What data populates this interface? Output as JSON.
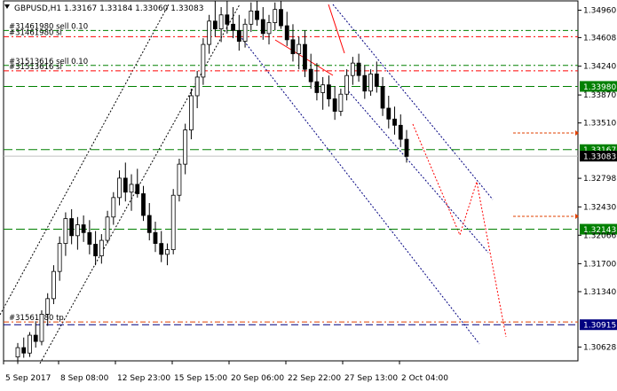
{
  "window": {
    "title": "GBPUSD,H1  1.33167 1.33184 1.33060 1.33083"
  },
  "colors": {
    "background": "#ffffff",
    "candle": "#000000",
    "price_badge": "#008000",
    "price_badge_text": "#ffffff",
    "green_line": "#008000",
    "red_line": "#ff0000",
    "orange_line": "#e04000",
    "blue_line": "#000080"
  },
  "chart_data": {
    "type": "candlestick",
    "title": "GBPUSD,H1  1.33167 1.33184 1.33060 1.33083",
    "ylim": [
      1.3045,
      1.3508
    ],
    "y_ticks": [
      1.3496,
      1.34608,
      1.3424,
      1.3387,
      1.3351,
      1.32798,
      1.3243,
      1.32066,
      1.317,
      1.3134,
      1.30628
    ],
    "x_ticks": [
      "5 Sep 2017",
      "8 Sep 08:00",
      "12 Sep 23:00",
      "15 Sep 15:00",
      "20 Sep 06:00",
      "22 Sep 22:00",
      "27 Sep 13:00",
      "2 Oct 04:00"
    ],
    "price_levels": [
      {
        "label": "1.33980",
        "value": 1.3398,
        "style": "green-dash"
      },
      {
        "label": "1.33167",
        "value": 1.33167,
        "style": "green-dash"
      },
      {
        "label": "1.33083",
        "value": 1.33083,
        "style": "bid"
      },
      {
        "label": "1.32143",
        "value": 1.32143,
        "style": "green-dash"
      },
      {
        "label": "1.30915",
        "value": 1.30915,
        "style": "blue-dash"
      }
    ],
    "orders": [
      {
        "label": "#31461980 sell 0.10",
        "value": 1.347
      },
      {
        "label": "#31461980 sl",
        "value": 1.3462
      },
      {
        "label": "#31513616 sell 0.10",
        "value": 1.3425
      },
      {
        "label": "#31513616 sl",
        "value": 1.3418
      },
      {
        "label": "#31561980 tp",
        "value": 1.3095
      }
    ],
    "candles": [
      {
        "o": 1.305,
        "h": 1.3068,
        "l": 1.3041,
        "c": 1.3062
      },
      {
        "o": 1.3062,
        "h": 1.3075,
        "l": 1.3049,
        "c": 1.3055
      },
      {
        "o": 1.3055,
        "h": 1.3082,
        "l": 1.305,
        "c": 1.3078
      },
      {
        "o": 1.3078,
        "h": 1.3096,
        "l": 1.3062,
        "c": 1.307
      },
      {
        "o": 1.307,
        "h": 1.311,
        "l": 1.3065,
        "c": 1.3105
      },
      {
        "o": 1.3105,
        "h": 1.3132,
        "l": 1.309,
        "c": 1.3125
      },
      {
        "o": 1.3125,
        "h": 1.3168,
        "l": 1.3118,
        "c": 1.316
      },
      {
        "o": 1.316,
        "h": 1.3205,
        "l": 1.3148,
        "c": 1.3196
      },
      {
        "o": 1.3196,
        "h": 1.3236,
        "l": 1.318,
        "c": 1.3228
      },
      {
        "o": 1.3228,
        "h": 1.324,
        "l": 1.3195,
        "c": 1.3206
      },
      {
        "o": 1.3206,
        "h": 1.323,
        "l": 1.3188,
        "c": 1.322
      },
      {
        "o": 1.322,
        "h": 1.3232,
        "l": 1.3198,
        "c": 1.321
      },
      {
        "o": 1.321,
        "h": 1.3226,
        "l": 1.3182,
        "c": 1.3195
      },
      {
        "o": 1.3195,
        "h": 1.3212,
        "l": 1.3168,
        "c": 1.318
      },
      {
        "o": 1.318,
        "h": 1.3208,
        "l": 1.317,
        "c": 1.32
      },
      {
        "o": 1.32,
        "h": 1.3238,
        "l": 1.3196,
        "c": 1.323
      },
      {
        "o": 1.323,
        "h": 1.3262,
        "l": 1.322,
        "c": 1.3255
      },
      {
        "o": 1.3255,
        "h": 1.329,
        "l": 1.3245,
        "c": 1.328
      },
      {
        "o": 1.328,
        "h": 1.33,
        "l": 1.325,
        "c": 1.3262
      },
      {
        "o": 1.3262,
        "h": 1.3285,
        "l": 1.3238,
        "c": 1.3272
      },
      {
        "o": 1.3272,
        "h": 1.3292,
        "l": 1.3255,
        "c": 1.326
      },
      {
        "o": 1.326,
        "h": 1.327,
        "l": 1.3225,
        "c": 1.3232
      },
      {
        "o": 1.3232,
        "h": 1.3248,
        "l": 1.32,
        "c": 1.321
      },
      {
        "o": 1.321,
        "h": 1.3224,
        "l": 1.3185,
        "c": 1.3196
      },
      {
        "o": 1.3196,
        "h": 1.3212,
        "l": 1.3172,
        "c": 1.3182
      },
      {
        "o": 1.3182,
        "h": 1.3196,
        "l": 1.3168,
        "c": 1.3188
      },
      {
        "o": 1.3188,
        "h": 1.3266,
        "l": 1.3182,
        "c": 1.3258
      },
      {
        "o": 1.3258,
        "h": 1.3305,
        "l": 1.325,
        "c": 1.3298
      },
      {
        "o": 1.3298,
        "h": 1.335,
        "l": 1.3285,
        "c": 1.3342
      },
      {
        "o": 1.3342,
        "h": 1.3395,
        "l": 1.333,
        "c": 1.3386
      },
      {
        "o": 1.3386,
        "h": 1.3418,
        "l": 1.337,
        "c": 1.341
      },
      {
        "o": 1.341,
        "h": 1.346,
        "l": 1.34,
        "c": 1.3452
      },
      {
        "o": 1.3452,
        "h": 1.349,
        "l": 1.344,
        "c": 1.3482
      },
      {
        "o": 1.3482,
        "h": 1.3508,
        "l": 1.3462,
        "c": 1.3472
      },
      {
        "o": 1.3472,
        "h": 1.35,
        "l": 1.3455,
        "c": 1.349
      },
      {
        "o": 1.349,
        "h": 1.3508,
        "l": 1.3466,
        "c": 1.3478
      },
      {
        "o": 1.3478,
        "h": 1.35,
        "l": 1.346,
        "c": 1.347
      },
      {
        "o": 1.347,
        "h": 1.349,
        "l": 1.3444,
        "c": 1.3456
      },
      {
        "o": 1.3456,
        "h": 1.3485,
        "l": 1.3448,
        "c": 1.3478
      },
      {
        "o": 1.3478,
        "h": 1.3506,
        "l": 1.3468,
        "c": 1.3495
      },
      {
        "o": 1.3495,
        "h": 1.3508,
        "l": 1.3476,
        "c": 1.3484
      },
      {
        "o": 1.3484,
        "h": 1.35,
        "l": 1.3458,
        "c": 1.3466
      },
      {
        "o": 1.3466,
        "h": 1.349,
        "l": 1.3452,
        "c": 1.348
      },
      {
        "o": 1.348,
        "h": 1.3506,
        "l": 1.347,
        "c": 1.3497
      },
      {
        "o": 1.3497,
        "h": 1.3508,
        "l": 1.3472,
        "c": 1.3476
      },
      {
        "o": 1.3476,
        "h": 1.3494,
        "l": 1.345,
        "c": 1.3458
      },
      {
        "o": 1.3458,
        "h": 1.3478,
        "l": 1.343,
        "c": 1.344
      },
      {
        "o": 1.344,
        "h": 1.3462,
        "l": 1.342,
        "c": 1.3452
      },
      {
        "o": 1.3452,
        "h": 1.347,
        "l": 1.341,
        "c": 1.342
      },
      {
        "o": 1.342,
        "h": 1.344,
        "l": 1.3395,
        "c": 1.3404
      },
      {
        "o": 1.3404,
        "h": 1.3428,
        "l": 1.338,
        "c": 1.339
      },
      {
        "o": 1.339,
        "h": 1.341,
        "l": 1.3368,
        "c": 1.34
      },
      {
        "o": 1.34,
        "h": 1.3412,
        "l": 1.3372,
        "c": 1.3382
      },
      {
        "o": 1.3382,
        "h": 1.3398,
        "l": 1.3355,
        "c": 1.3366
      },
      {
        "o": 1.3366,
        "h": 1.3395,
        "l": 1.336,
        "c": 1.3388
      },
      {
        "o": 1.3388,
        "h": 1.342,
        "l": 1.338,
        "c": 1.3412
      },
      {
        "o": 1.3412,
        "h": 1.3436,
        "l": 1.34,
        "c": 1.3428
      },
      {
        "o": 1.3428,
        "h": 1.344,
        "l": 1.3404,
        "c": 1.3412
      },
      {
        "o": 1.3412,
        "h": 1.3425,
        "l": 1.3382,
        "c": 1.3392
      },
      {
        "o": 1.3392,
        "h": 1.342,
        "l": 1.3386,
        "c": 1.3414
      },
      {
        "o": 1.3414,
        "h": 1.343,
        "l": 1.339,
        "c": 1.3398
      },
      {
        "o": 1.3398,
        "h": 1.341,
        "l": 1.336,
        "c": 1.337
      },
      {
        "o": 1.337,
        "h": 1.3386,
        "l": 1.3344,
        "c": 1.3356
      },
      {
        "o": 1.3356,
        "h": 1.3372,
        "l": 1.3336,
        "c": 1.3348
      },
      {
        "o": 1.3348,
        "h": 1.3362,
        "l": 1.332,
        "c": 1.333
      },
      {
        "o": 1.333,
        "h": 1.3342,
        "l": 1.33,
        "c": 1.3308
      }
    ],
    "annotations": [
      "dotted black channel lines",
      "dotted navy channel lines",
      "red projected path",
      "orange dashed arrows",
      "red trend lines"
    ]
  }
}
